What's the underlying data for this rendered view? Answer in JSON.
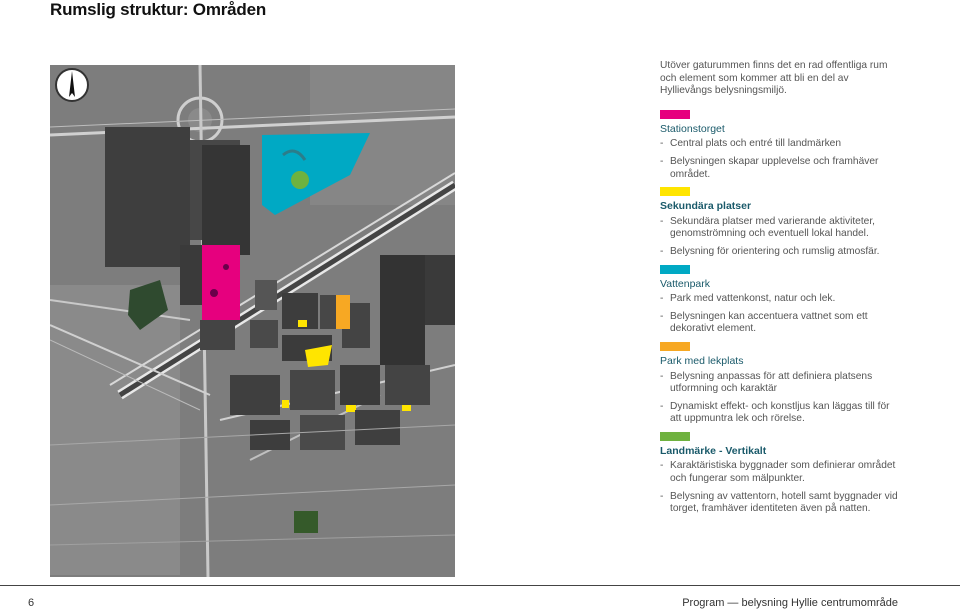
{
  "page": {
    "title": "Rumslig struktur: Områden",
    "page_number": "6",
    "footer": "Program — belysning Hyllie centrumområde"
  },
  "map": {
    "compass_icon": "north-arrow-icon",
    "colors": {
      "stationstorget": "#e6007e",
      "sekundara": "#ffe500",
      "vattenpark": "#00a9c4",
      "lekplats": "#f7a823",
      "landmarke": "#6fb23f"
    }
  },
  "legend": {
    "intro": "Utöver gaturummen finns det en rad offentliga rum och element som kommer att bli en del av Hyllievångs belysningsmiljö.",
    "sections": [
      {
        "color": "#e6007e",
        "title": "Stationstorget",
        "bold": false,
        "items": [
          "Central plats och entré till landmärken",
          "Belysningen skapar upplevelse och framhäver området."
        ]
      },
      {
        "color": "#ffe500",
        "title": "Sekundära platser",
        "bold": true,
        "items": [
          "Sekundära platser med varierande aktiviteter, genomströmning och eventuell lokal handel.",
          "Belysning för orientering och rumslig atmosfär."
        ]
      },
      {
        "color": "#00a9c4",
        "title": "Vattenpark",
        "bold": false,
        "items": [
          "Park med vattenkonst, natur och lek.",
          "Belysningen kan accentuera vattnet som ett dekorativt element."
        ]
      },
      {
        "color": "#f7a823",
        "title": "Park med lekplats",
        "bold": false,
        "items": [
          "Belysning anpassas för att definiera platsens utformning och karaktär",
          "Dynamiskt effekt- och konstljus kan läggas till för att uppmuntra lek och rörelse."
        ]
      },
      {
        "color": "#6fb23f",
        "title": "Landmärke - Vertikalt",
        "bold": true,
        "items": [
          "Karaktäristiska byggnader som definierar området och fungerar som mälpunkter.",
          "Belysning av vattentorn, hotell samt byggnader vid torget, framhäver identiteten även på natten."
        ]
      }
    ]
  }
}
